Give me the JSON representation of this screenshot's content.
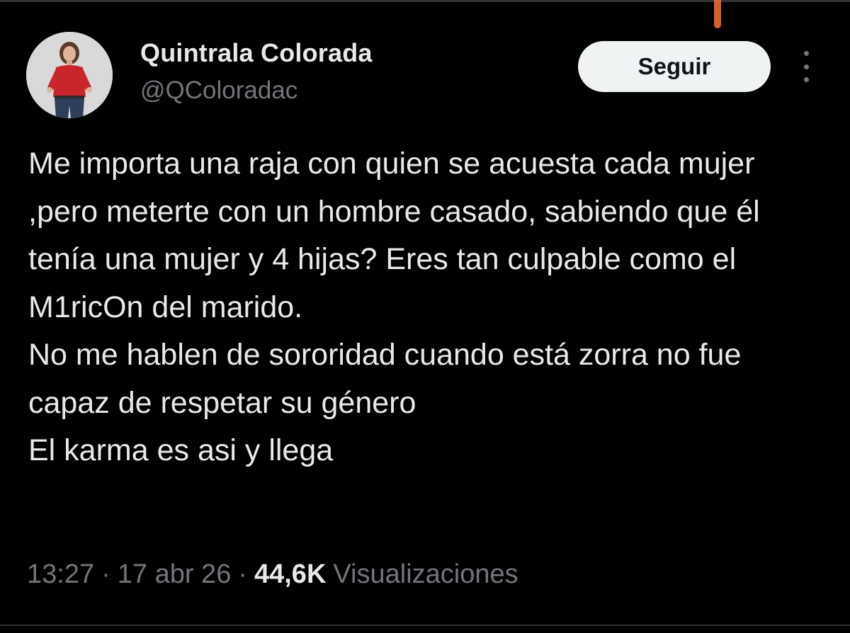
{
  "author": {
    "name": "Quintrala Colorada",
    "handle": "@QColoradac",
    "avatar": "profile-photo"
  },
  "follow_button": {
    "label": "Seguir"
  },
  "more_menu": {
    "icon": "vertical-ellipsis-icon"
  },
  "tweet": {
    "text": "Me importa una raja con quien se acuesta cada mujer ,pero meterte con un hombre casado, sabiendo que él tenía una mujer y 4 hijas? Eres tan culpable como el M1ricOn del marido.\nNo me hablen de sororidad cuando está zorra no fue capaz de respetar su género\nEl karma es asi y llega"
  },
  "meta": {
    "time": "13:27",
    "separator": "·",
    "date": "17 abr 26",
    "views_count": "44,6K",
    "views_label": "Visualizaciones"
  },
  "colors": {
    "background": "#000000",
    "primary_text": "#e7e9ea",
    "secondary_text": "#71767b",
    "button_bg": "#eff3f4",
    "button_text": "#0f1419",
    "annotation_mark": "#f26a2e"
  }
}
